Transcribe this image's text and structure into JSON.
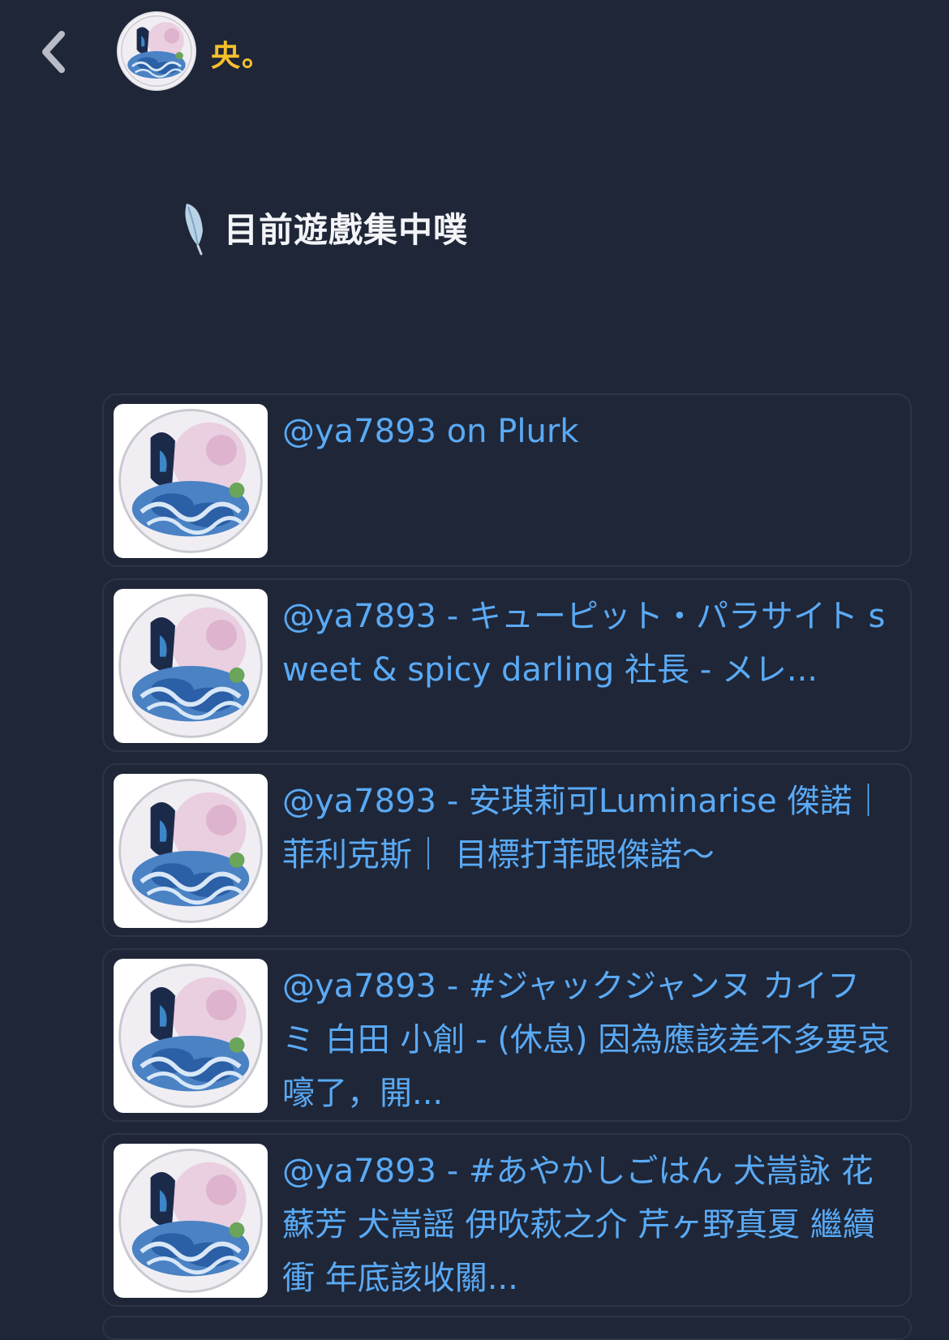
{
  "header": {
    "back_icon": "chevron-left-icon",
    "username": "央。"
  },
  "section": {
    "icon": "feather-icon",
    "title": "目前遊戲集中噗"
  },
  "cards": [
    {
      "text": "@ya7893 on Plurk"
    },
    {
      "text": "@ya7893 - キューピット・パラサイト sweet & spicy darling 社長 - メレ..."
    },
    {
      "text": "@ya7893 - 安琪莉可Luminarise 傑諾｜菲利克斯｜ 目標打菲跟傑諾～"
    },
    {
      "text": "@ya7893 - #ジャックジャンヌ カイフミ 白田 小創 - (休息) 因為應該差不多要哀嚎了，開..."
    },
    {
      "text": "@ya7893 - #あやかしごはん 犬嵩詠 花蘇芳 犬嵩謡 伊吹萩之介 芹ヶ野真夏 繼續衝 年底該收關..."
    }
  ],
  "colors": {
    "background": "#1f2637",
    "username": "#f4c02c",
    "link": "#5aaaf5",
    "card_border": "#2c3447"
  }
}
